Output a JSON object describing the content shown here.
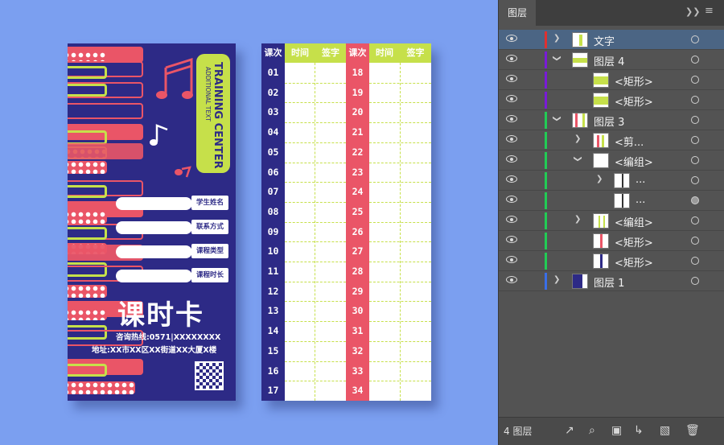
{
  "front_card": {
    "brand_title": "TRAINING CENTER",
    "brand_subtitle": "ADDITIONAL TEXT",
    "fields": [
      {
        "label": "学生姓名"
      },
      {
        "label": "联系方式"
      },
      {
        "label": "课程类型"
      },
      {
        "label": "课程时长"
      }
    ],
    "title": "课时卡",
    "hotline": "咨询热线:0571|XXXXXXXX",
    "address": "地址:XX市XX区XX街道XX大厦X楼",
    "colors": {
      "navy": "#2d2a86",
      "pink": "#ea5567",
      "lime": "#c6e04a"
    }
  },
  "back_card": {
    "headers": {
      "lesson": "课次",
      "time": "时间",
      "sign": "签字"
    },
    "left_lessons": [
      "01",
      "02",
      "03",
      "04",
      "05",
      "06",
      "07",
      "08",
      "09",
      "10",
      "11",
      "12",
      "13",
      "14",
      "15",
      "16",
      "17"
    ],
    "right_lessons": [
      "18",
      "19",
      "20",
      "21",
      "22",
      "23",
      "24",
      "25",
      "26",
      "27",
      "28",
      "29",
      "30",
      "31",
      "32",
      "33",
      "34"
    ]
  },
  "layers_panel": {
    "tab": "图层",
    "layer_count": "4 图层",
    "rows": [
      {
        "name": "文字",
        "color": "#e03030",
        "selected": true
      },
      {
        "name": "图层 4",
        "color": "#7a1ad8"
      },
      {
        "name": "<矩形>",
        "color": "#7a1ad8"
      },
      {
        "name": "<矩形>",
        "color": "#7a1ad8"
      },
      {
        "name": "图层 3",
        "color": "#22cc55"
      },
      {
        "name": "<剪...",
        "color": "#22cc55"
      },
      {
        "name": "<编组>",
        "color": "#22cc55"
      },
      {
        "name": "...",
        "color": "#22cc55"
      },
      {
        "name": "...",
        "color": "#22cc55"
      },
      {
        "name": "<编组>",
        "color": "#22cc55"
      },
      {
        "name": "<矩形>",
        "color": "#22cc55"
      },
      {
        "name": "<矩形>",
        "color": "#22cc55"
      },
      {
        "name": "图层 1",
        "color": "#3a6ee8"
      }
    ]
  }
}
